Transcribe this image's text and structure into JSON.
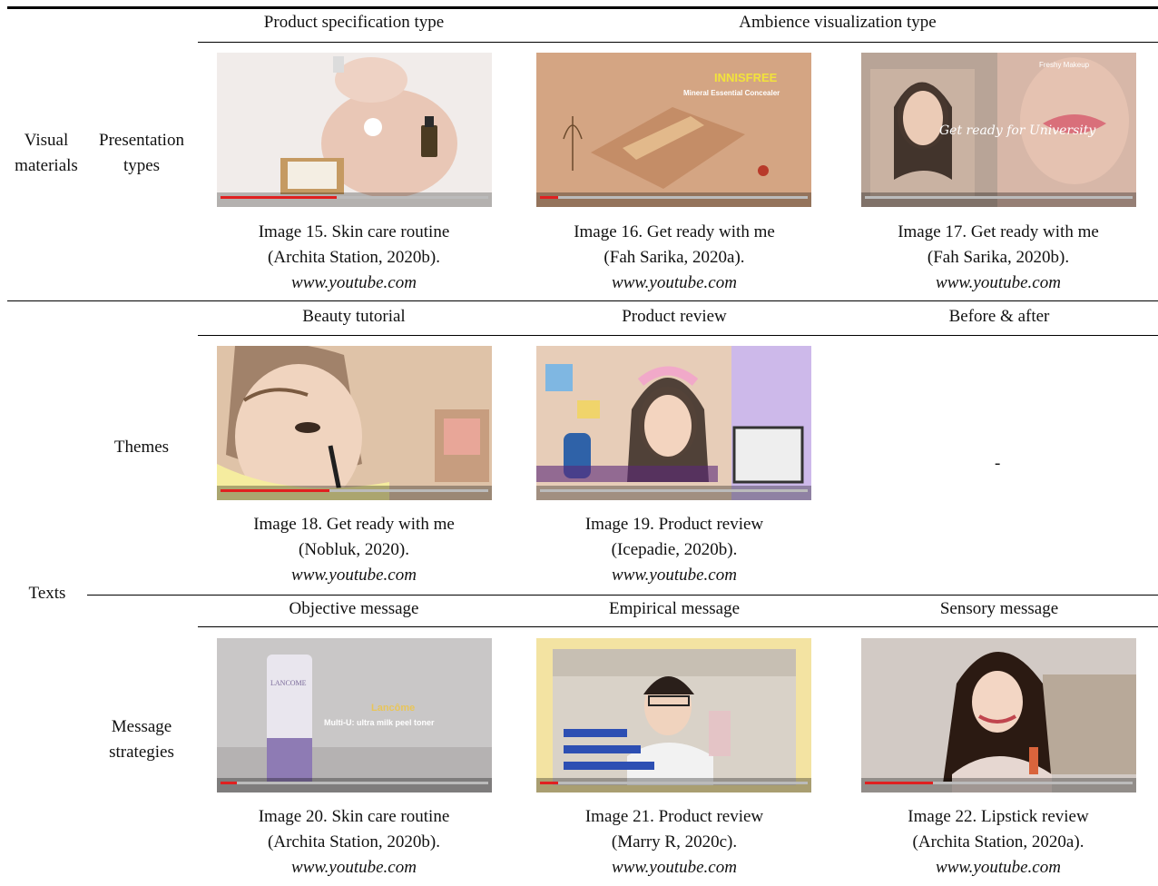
{
  "rows": {
    "visual": {
      "group": "Visual\nmaterials",
      "sub": "Presentation\ntypes"
    },
    "texts": {
      "group": "Texts",
      "themes": "Themes",
      "messages": "Message\nstrategies"
    }
  },
  "headers": {
    "product_spec": "Product specification type",
    "ambience": "Ambience visualization type",
    "beauty_tutorial": "Beauty tutorial",
    "product_review": "Product review",
    "before_after": "Before & after",
    "objective": "Objective message",
    "empirical": "Empirical message",
    "sensory": "Sensory message"
  },
  "empty_cell": "-",
  "captions": [
    {
      "line1": "Image 15. Skin care routine",
      "line2": "(Archita Station, 2020b).",
      "src": "www.youtube.com"
    },
    {
      "line1": "Image 16. Get ready with me",
      "line2": "(Fah Sarika, 2020a).",
      "src": "www.youtube.com"
    },
    {
      "line1": "Image 17. Get ready with me",
      "line2": "(Fah Sarika, 2020b).",
      "src": "www.youtube.com"
    },
    {
      "line1": "Image 18. Get ready with me",
      "line2": "(Nobluk, 2020).",
      "src": "www.youtube.com"
    },
    {
      "line1": "Image 19. Product review",
      "line2": "(Icepadie, 2020b).",
      "src": "www.youtube.com"
    },
    {
      "line1": "Image 20. Skin care routine",
      "line2": "(Archita Station, 2020b).",
      "src": "www.youtube.com"
    },
    {
      "line1": "Image 21. Product review",
      "line2": "(Marry R, 2020c).",
      "src": "www.youtube.com"
    },
    {
      "line1": "Image 22. Lipstick review",
      "line2": "(Archita Station, 2020a).",
      "src": "www.youtube.com"
    }
  ],
  "thumb_text": {
    "img16_brand": "INNISFREE",
    "img16_product": "Mineral Essential Concealer",
    "img17_script": "Get ready for University",
    "img17_corner": "Freshy Makeup",
    "img20_brand": "Lancôme",
    "img20_product": "Multi-U: ultra milk peel toner",
    "img20_bottle": "LANCOME"
  }
}
